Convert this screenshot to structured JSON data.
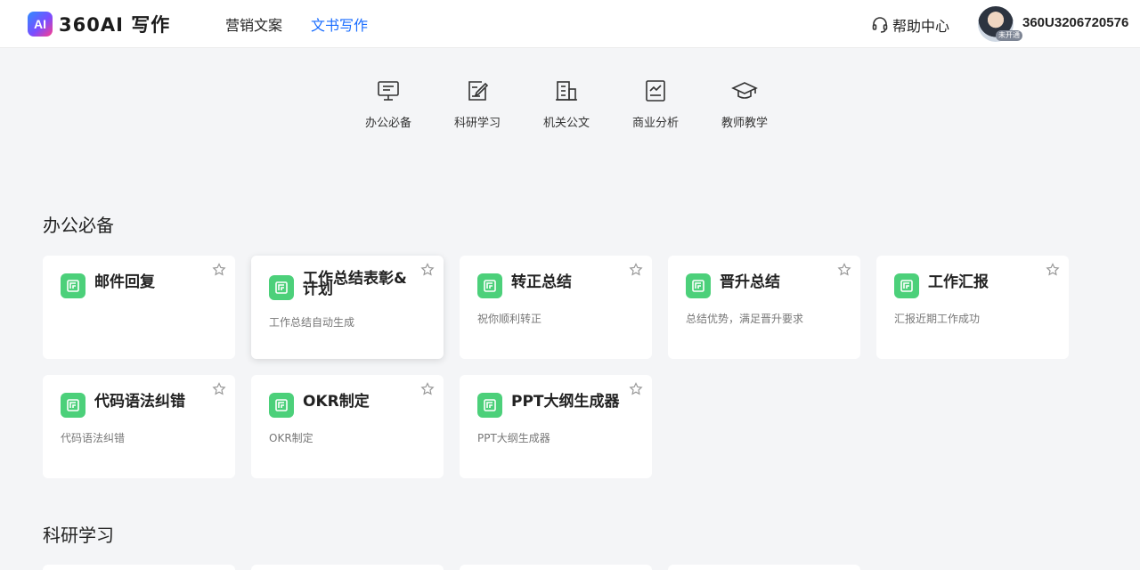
{
  "header": {
    "logo_badge": "AI",
    "logo_text": "360AI 写作",
    "nav": [
      {
        "label": "营销文案",
        "active": false
      },
      {
        "label": "文书写作",
        "active": true
      }
    ],
    "help_label": "帮助中心",
    "avatar_badge": "未开通",
    "username": "360U3206720576"
  },
  "categories": [
    {
      "label": "办公必备",
      "icon": "monitor-icon"
    },
    {
      "label": "科研学习",
      "icon": "edit-note-icon"
    },
    {
      "label": "机关公文",
      "icon": "building-icon"
    },
    {
      "label": "商业分析",
      "icon": "chart-board-icon"
    },
    {
      "label": "教师教学",
      "icon": "graduation-cap-icon"
    }
  ],
  "sections": [
    {
      "title": "办公必备",
      "cards": [
        {
          "title": "邮件回复",
          "desc": ""
        },
        {
          "title": "工作总结表彰&计划",
          "desc": "工作总结自动生成"
        },
        {
          "title": "转正总结",
          "desc": "祝你顺利转正"
        },
        {
          "title": "晋升总结",
          "desc": "总结优势，满足晋升要求"
        },
        {
          "title": "工作汇报",
          "desc": "汇报近期工作成功"
        },
        {
          "title": "代码语法纠错",
          "desc": "代码语法纠错"
        },
        {
          "title": "OKR制定",
          "desc": "OKR制定"
        },
        {
          "title": "PPT大纲生成器",
          "desc": "PPT大纲生成器"
        }
      ]
    },
    {
      "title": "科研学习",
      "cards": []
    }
  ],
  "colors": {
    "accent": "#1a6dff",
    "card_icon": "#4cd07a",
    "background": "#f4f5f7"
  }
}
